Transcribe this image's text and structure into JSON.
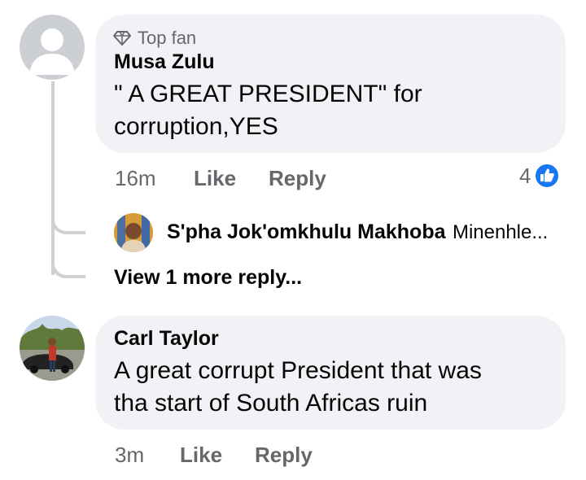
{
  "comments": [
    {
      "badge": "Top fan",
      "badge_icon": "diamond-icon",
      "author": "Musa Zulu",
      "text_lines": [
        "\" A GREAT PRESIDENT\" for",
        "corruption,YES"
      ],
      "time": "16m",
      "like_label": "Like",
      "reply_label": "Reply",
      "reaction_count": "4",
      "reaction_icon": "like-reaction-icon",
      "reply_preview": {
        "author": "S'pha Jok'omkhulu Makhoba",
        "snippet": "Minenhle..."
      },
      "view_more_label": "View 1 more reply..."
    },
    {
      "author": "Carl Taylor",
      "text_lines": [
        "A great corrupt President that was",
        "tha start of South Africas ruin"
      ],
      "time": "3m",
      "like_label": "Like",
      "reply_label": "Reply"
    }
  ],
  "colors": {
    "bubble": "#f0f2f5",
    "meta_text": "#65676b",
    "like_blue": "#1877f2",
    "thread_line": "#ced0d4"
  }
}
